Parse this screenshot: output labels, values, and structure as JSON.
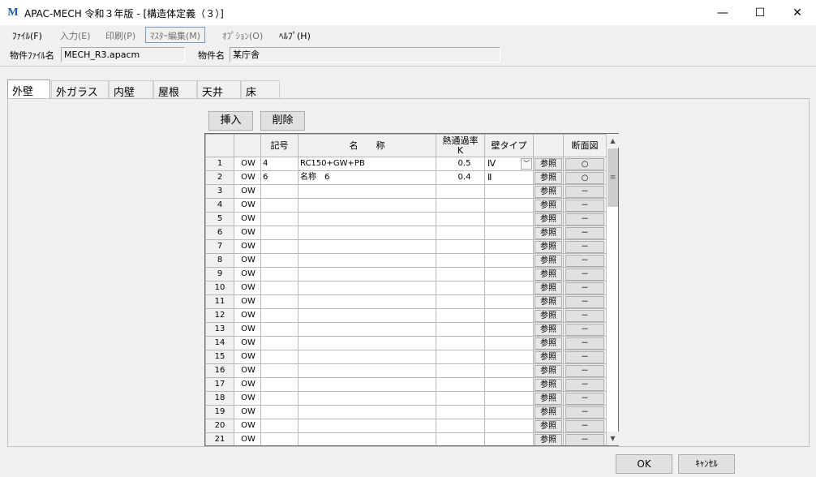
{
  "window": {
    "title": "APAC-MECH 令和３年版 - [構造体定義（３）]",
    "controls": {
      "minimize": "—",
      "maximize": "☐",
      "close": "✕"
    }
  },
  "menu": [
    {
      "label": "ﾌｧｲﾙ(F)",
      "state": "enabled"
    },
    {
      "label": "入力(E)",
      "state": "disabled"
    },
    {
      "label": "印刷(P)",
      "state": "disabled"
    },
    {
      "label": "ﾏｽﾀｰ編集(M)",
      "state": "selected"
    },
    {
      "label": "ｵﾌﾟｼｮﾝ(O)",
      "state": "disabled"
    },
    {
      "label": "ﾍﾙﾌﾟ(H)",
      "state": "enabled"
    }
  ],
  "info": {
    "file_label": "物件ﾌｧｲﾙ名",
    "file_value": "MECH_R3.apacm",
    "name_label": "物件名",
    "name_value": "某庁舎"
  },
  "tabs": [
    {
      "label": "外壁",
      "active": true
    },
    {
      "label": "外ガラス",
      "active": false
    },
    {
      "label": "内壁",
      "active": false
    },
    {
      "label": "屋根",
      "active": false
    },
    {
      "label": "天井",
      "active": false
    },
    {
      "label": "床",
      "active": false
    }
  ],
  "actions": {
    "insert": "挿入",
    "delete": "削除"
  },
  "grid": {
    "headers": {
      "blank1": "",
      "blank2": "",
      "symbol": "記号",
      "name": "名　　称",
      "k_line1": "熱通過率",
      "k_line2": "K",
      "wall_type": "壁タイプ",
      "ref": "",
      "section": "断面図"
    },
    "ref_label": "参照",
    "rows": [
      {
        "no": "1",
        "code": "OW",
        "symbol": "4",
        "name": "RC150+GW+PB",
        "k": "0.5",
        "wall": "Ⅳ",
        "dropdown": true,
        "section": "○"
      },
      {
        "no": "2",
        "code": "OW",
        "symbol": "6",
        "name": "名称　6",
        "k": "0.4",
        "wall": "Ⅱ",
        "dropdown": false,
        "section": "○"
      },
      {
        "no": "3",
        "code": "OW",
        "symbol": "",
        "name": "",
        "k": "",
        "wall": "",
        "dropdown": false,
        "section": "－"
      },
      {
        "no": "4",
        "code": "OW",
        "symbol": "",
        "name": "",
        "k": "",
        "wall": "",
        "dropdown": false,
        "section": "－"
      },
      {
        "no": "5",
        "code": "OW",
        "symbol": "",
        "name": "",
        "k": "",
        "wall": "",
        "dropdown": false,
        "section": "－"
      },
      {
        "no": "6",
        "code": "OW",
        "symbol": "",
        "name": "",
        "k": "",
        "wall": "",
        "dropdown": false,
        "section": "－"
      },
      {
        "no": "7",
        "code": "OW",
        "symbol": "",
        "name": "",
        "k": "",
        "wall": "",
        "dropdown": false,
        "section": "－"
      },
      {
        "no": "8",
        "code": "OW",
        "symbol": "",
        "name": "",
        "k": "",
        "wall": "",
        "dropdown": false,
        "section": "－"
      },
      {
        "no": "9",
        "code": "OW",
        "symbol": "",
        "name": "",
        "k": "",
        "wall": "",
        "dropdown": false,
        "section": "－"
      },
      {
        "no": "10",
        "code": "OW",
        "symbol": "",
        "name": "",
        "k": "",
        "wall": "",
        "dropdown": false,
        "section": "－"
      },
      {
        "no": "11",
        "code": "OW",
        "symbol": "",
        "name": "",
        "k": "",
        "wall": "",
        "dropdown": false,
        "section": "－"
      },
      {
        "no": "12",
        "code": "OW",
        "symbol": "",
        "name": "",
        "k": "",
        "wall": "",
        "dropdown": false,
        "section": "－"
      },
      {
        "no": "13",
        "code": "OW",
        "symbol": "",
        "name": "",
        "k": "",
        "wall": "",
        "dropdown": false,
        "section": "－"
      },
      {
        "no": "14",
        "code": "OW",
        "symbol": "",
        "name": "",
        "k": "",
        "wall": "",
        "dropdown": false,
        "section": "－"
      },
      {
        "no": "15",
        "code": "OW",
        "symbol": "",
        "name": "",
        "k": "",
        "wall": "",
        "dropdown": false,
        "section": "－"
      },
      {
        "no": "16",
        "code": "OW",
        "symbol": "",
        "name": "",
        "k": "",
        "wall": "",
        "dropdown": false,
        "section": "－"
      },
      {
        "no": "17",
        "code": "OW",
        "symbol": "",
        "name": "",
        "k": "",
        "wall": "",
        "dropdown": false,
        "section": "－"
      },
      {
        "no": "18",
        "code": "OW",
        "symbol": "",
        "name": "",
        "k": "",
        "wall": "",
        "dropdown": false,
        "section": "－"
      },
      {
        "no": "19",
        "code": "OW",
        "symbol": "",
        "name": "",
        "k": "",
        "wall": "",
        "dropdown": false,
        "section": "－"
      },
      {
        "no": "20",
        "code": "OW",
        "symbol": "",
        "name": "",
        "k": "",
        "wall": "",
        "dropdown": false,
        "section": "－"
      },
      {
        "no": "21",
        "code": "OW",
        "symbol": "",
        "name": "",
        "k": "",
        "wall": "",
        "dropdown": false,
        "section": "－"
      }
    ]
  },
  "scrollbar": {
    "up": "▲",
    "down": "▼",
    "thumb_grip": "≡"
  },
  "footer": {
    "ok": "OK",
    "cancel": "ｷｬﾝｾﾙ"
  },
  "colors": {
    "accent": "#1e5bb8",
    "scrollbar_track": "#6d8ecb",
    "menu_highlight": "#7a9cc8"
  }
}
